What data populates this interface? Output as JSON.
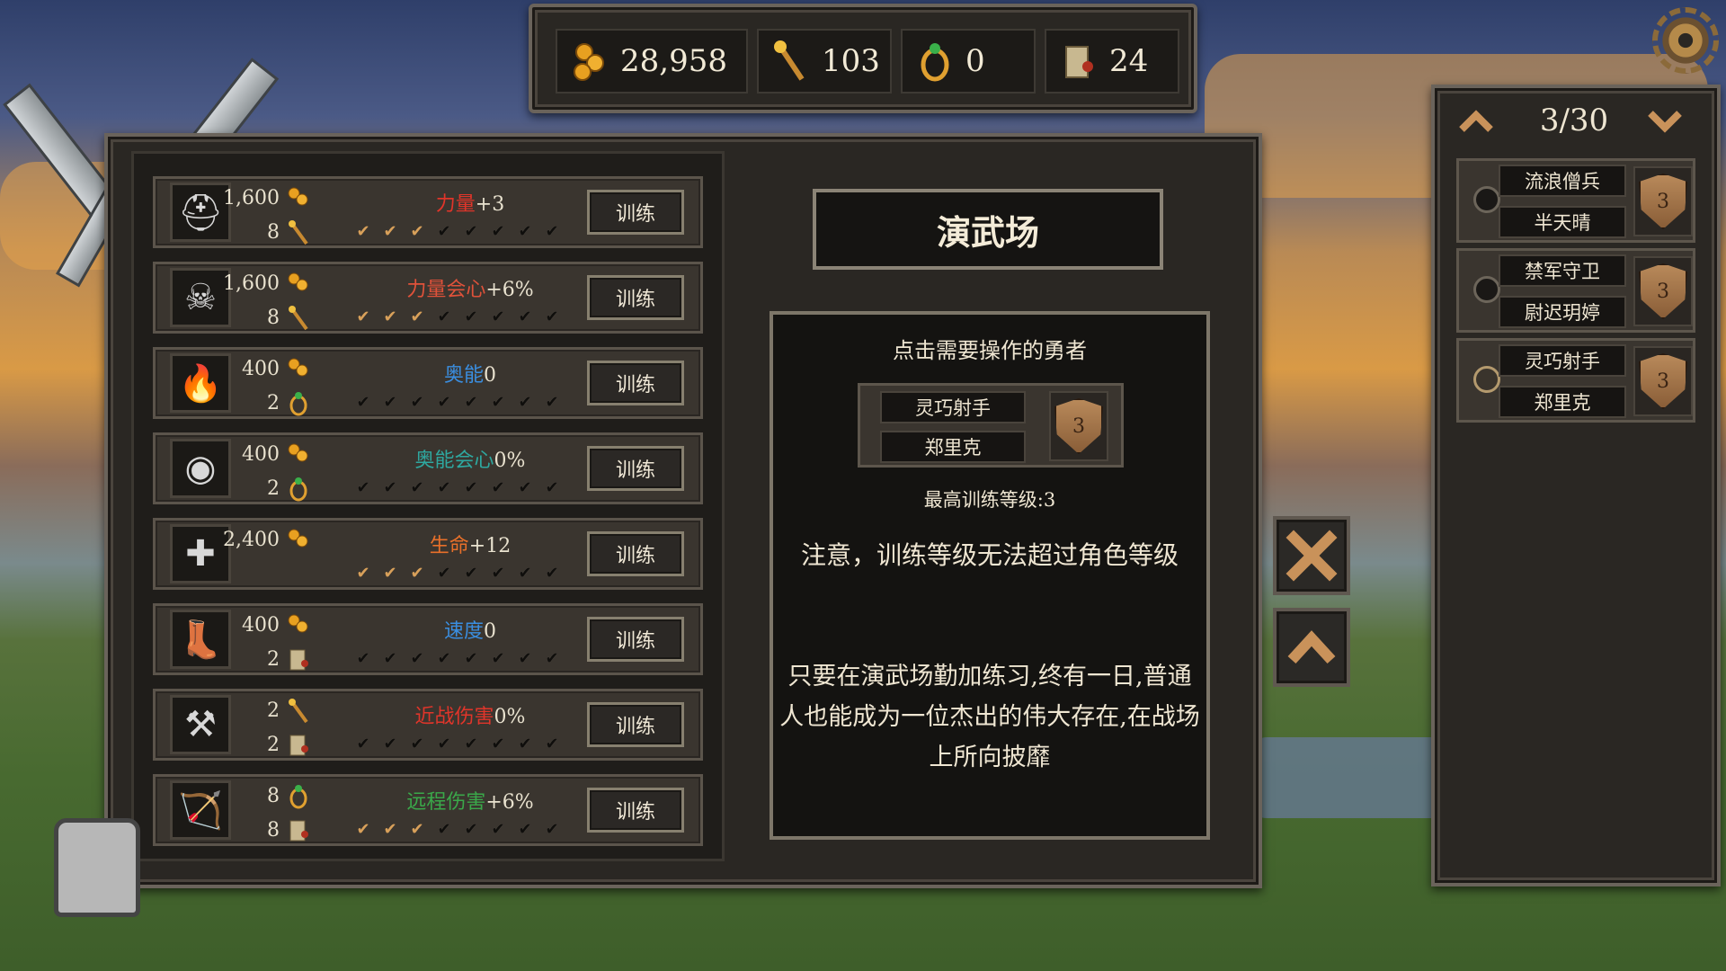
{
  "resources": [
    {
      "icon": "gold-coins-icon",
      "value": "28,958"
    },
    {
      "icon": "torch-icon",
      "value": "103"
    },
    {
      "icon": "ring-icon",
      "value": "0"
    },
    {
      "icon": "scroll-icon",
      "value": "24"
    }
  ],
  "training": {
    "rows": [
      {
        "icon": "helmet-icon",
        "glyph": "⛑",
        "cost1": "1,600",
        "cost1_icon": "gold-coins-icon",
        "cost2": "8",
        "cost2_icon": "torch-icon",
        "stat": "力量",
        "value": "+3",
        "color": "#e0352a",
        "filled": 3,
        "button": "训练"
      },
      {
        "icon": "demon-skull-icon",
        "glyph": "☠",
        "cost1": "1,600",
        "cost1_icon": "gold-coins-icon",
        "cost2": "8",
        "cost2_icon": "torch-icon",
        "stat": "力量会心",
        "value": "+6%",
        "color": "#e0523a",
        "filled": 3,
        "button": "训练"
      },
      {
        "icon": "flame-icon",
        "glyph": "🔥",
        "cost1": "400",
        "cost1_icon": "gold-coins-icon",
        "cost2": "2",
        "cost2_icon": "ring-icon",
        "stat": "奥能",
        "value": "0",
        "color": "#3a8ee0",
        "filled": 0,
        "button": "训练"
      },
      {
        "icon": "arcane-medallion-icon",
        "glyph": "◉",
        "cost1": "400",
        "cost1_icon": "gold-coins-icon",
        "cost2": "2",
        "cost2_icon": "ring-icon",
        "stat": "奥能会心",
        "value": "0%",
        "color": "#2ea8a0",
        "filled": 0,
        "button": "训练"
      },
      {
        "icon": "cross-shield-icon",
        "glyph": "✚",
        "cost1": "2,400",
        "cost1_icon": "gold-coins-icon",
        "cost2": "",
        "cost2_icon": "",
        "stat": "生命",
        "value": "+12",
        "color": "#e8702a",
        "filled": 3,
        "button": "训练"
      },
      {
        "icon": "boots-icon",
        "glyph": "👢",
        "cost1": "400",
        "cost1_icon": "gold-coins-icon",
        "cost2": "2",
        "cost2_icon": "scroll-icon",
        "stat": "速度",
        "value": "0",
        "color": "#3a8ee0",
        "filled": 0,
        "button": "训练"
      },
      {
        "icon": "battle-axe-icon",
        "glyph": "⚒",
        "cost1": "2",
        "cost1_icon": "torch-icon",
        "cost2": "2",
        "cost2_icon": "scroll-icon",
        "stat": "近战伤害",
        "value": "0%",
        "color": "#e0352a",
        "filled": 0,
        "button": "训练"
      },
      {
        "icon": "bow-icon",
        "glyph": "🏹",
        "cost1": "8",
        "cost1_icon": "ring-icon",
        "cost2": "8",
        "cost2_icon": "scroll-icon",
        "stat": "远程伤害",
        "value": "+6%",
        "color": "#3aa84a",
        "filled": 3,
        "button": "训练"
      }
    ]
  },
  "title": "演武场",
  "info": {
    "prompt": "点击需要操作的勇者",
    "selected_hero": {
      "class": "灵巧射手",
      "name": "郑里克",
      "level": "3"
    },
    "max_level": "最高训练等级:3",
    "notice": "注意，训练等级无法超过角色等级",
    "flavor_line1": "只要在演武场勤加练习,终有一日,普通",
    "flavor_line2": "人也能成为一位杰出的伟大存在,在战场",
    "flavor_line3": "上所向披靡"
  },
  "roster": {
    "page": "3/30",
    "heroes": [
      {
        "class": "流浪僧兵",
        "name": "半天晴",
        "level": "3",
        "selected": false
      },
      {
        "class": "禁军守卫",
        "name": "尉迟玥婷",
        "level": "3",
        "selected": false
      },
      {
        "class": "灵巧射手",
        "name": "郑里克",
        "level": "3",
        "selected": true
      }
    ]
  }
}
